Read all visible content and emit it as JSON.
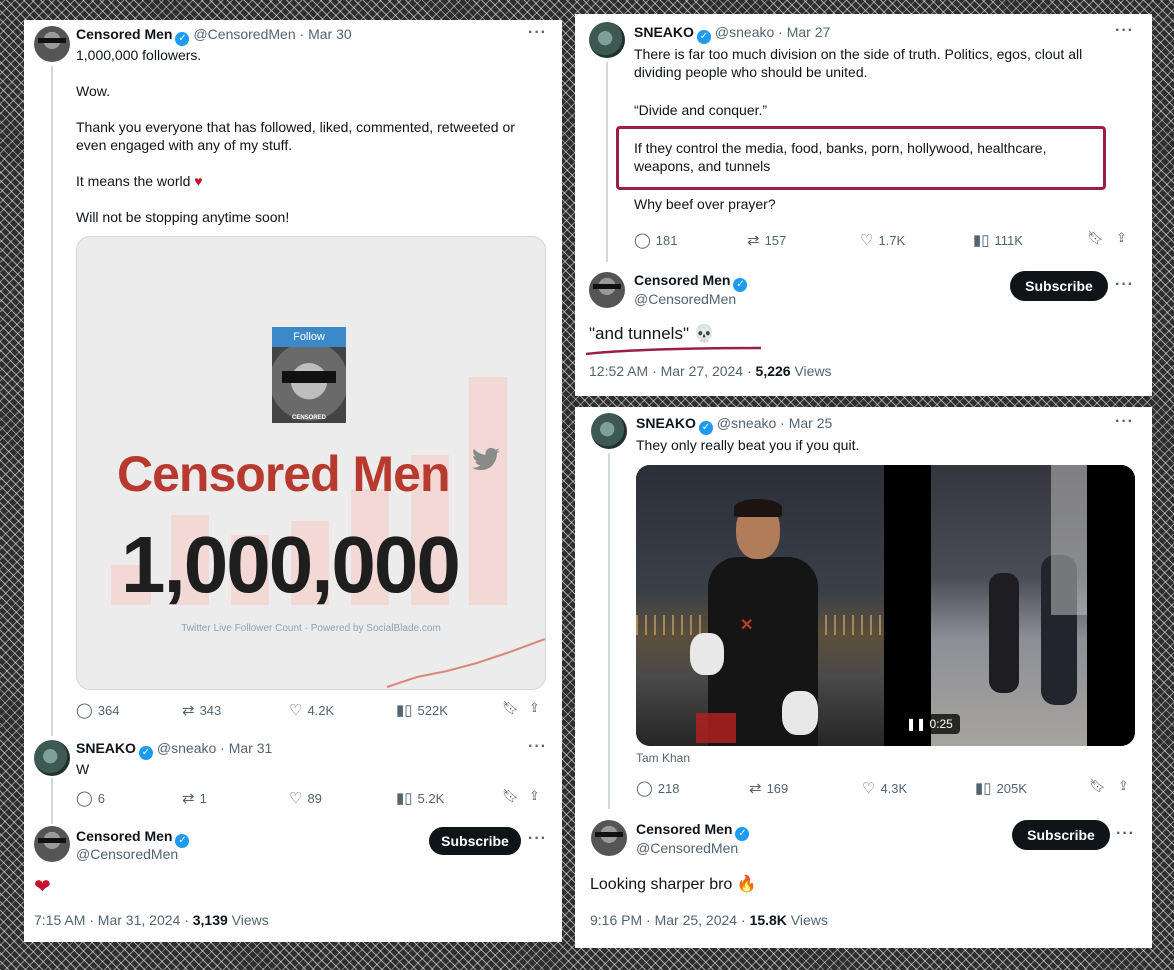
{
  "panel_left": {
    "tweet1": {
      "name": "Censored Men",
      "handle": "@CensoredMen",
      "date": "Mar 30",
      "lines": [
        "1,000,000 followers.",
        "Wow.",
        "Thank you everyone that has followed, liked, commented, retweeted or",
        "even engaged with any of my stuff.",
        "It means the world",
        "Will not be stopping anytime soon!"
      ],
      "card": {
        "follow_label": "Follow",
        "title": "Censored Men",
        "count": "1,000,000",
        "footer": "Twitter Live Follower Count · Powered by SocialBlade.com",
        "avatar_badge": "CENSORED"
      },
      "stats": {
        "replies": "364",
        "retweets": "343",
        "likes": "4.2K",
        "views": "522K"
      }
    },
    "tweet2": {
      "name": "SNEAKO",
      "handle": "@sneako",
      "date": "Mar 31",
      "text": "W",
      "stats": {
        "replies": "6",
        "retweets": "1",
        "likes": "89",
        "views": "5.2K"
      }
    },
    "tweet3": {
      "name": "Censored Men",
      "handle": "@CensoredMen",
      "subscribe": "Subscribe",
      "text": "❤",
      "time": "7:15 AM · Mar 31, 2024 · ",
      "views_count": "3,139",
      "views_label": " Views"
    }
  },
  "panel_top_right": {
    "tweet1": {
      "name": "SNEAKO",
      "handle": "@sneako",
      "date": "Mar 27",
      "lines": [
        "There is far too much division on the side of truth. Politics, egos, clout all",
        "dividing people who should be united.",
        "“Divide and conquer.”",
        "If they control the media, food, banks, porn, hollywood, healthcare,",
        "weapons, and tunnels",
        "Why beef over prayer?"
      ],
      "stats": {
        "replies": "181",
        "retweets": "157",
        "likes": "1.7K",
        "views": "111K"
      }
    },
    "tweet2": {
      "name": "Censored Men",
      "handle": "@CensoredMen",
      "subscribe": "Subscribe",
      "text": "\"and tunnels\" 💀",
      "time": "12:52 AM · Mar 27, 2024 · ",
      "views_count": "5,226",
      "views_label": " Views"
    }
  },
  "panel_bottom_right": {
    "tweet1": {
      "name": "SNEAKO",
      "handle": "@sneako",
      "date": "Mar 25",
      "text": "They only really beat you if you quit.",
      "media_caption": "Tam Khan",
      "video_time": "0:25",
      "stats": {
        "replies": "218",
        "retweets": "169",
        "likes": "4.3K",
        "views": "205K"
      }
    },
    "tweet2": {
      "name": "Censored Men",
      "handle": "@CensoredMen",
      "subscribe": "Subscribe",
      "text": "Looking sharper bro 🔥",
      "time": "9:16 PM · Mar 25, 2024 · ",
      "views_count": "15.8K",
      "views_label": " Views"
    }
  },
  "icons": {
    "reply": "reply-icon",
    "retweet": "retweet-icon",
    "like": "heart-icon",
    "views": "views-icon",
    "bookmark": "bookmark-icon",
    "share": "share-icon",
    "more": "more-icon",
    "verified": "verified-icon"
  },
  "colors": {
    "accent": "#1d9bf0",
    "highlight": "#9b1d4a",
    "heart": "#c8102e",
    "brand_red": "#c0392b"
  }
}
